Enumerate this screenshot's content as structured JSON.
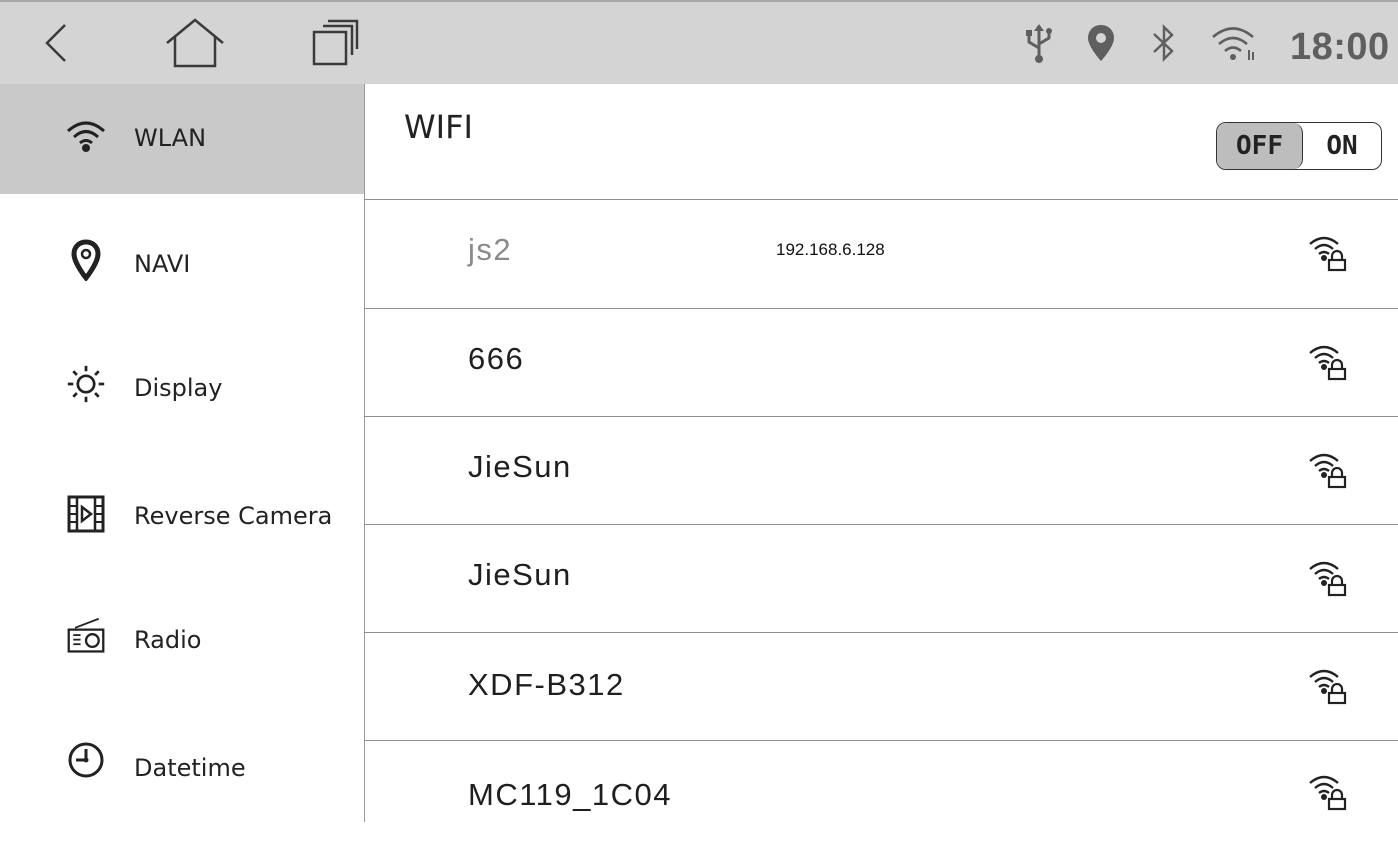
{
  "status_bar": {
    "clock": "18:00",
    "icons": [
      "back-icon",
      "home-icon",
      "recent-apps-icon",
      "usb-icon",
      "location-icon",
      "bluetooth-icon",
      "wifi-icon"
    ]
  },
  "sidebar": {
    "items": [
      {
        "label": "WLAN",
        "icon": "wifi-icon",
        "active": true
      },
      {
        "label": "NAVI",
        "icon": "location-pin-icon"
      },
      {
        "label": "Display",
        "icon": "brightness-icon"
      },
      {
        "label": "Reverse Camera",
        "icon": "film-play-icon"
      },
      {
        "label": "Radio",
        "icon": "radio-icon"
      },
      {
        "label": "Datetime",
        "icon": "clock-icon"
      }
    ]
  },
  "main": {
    "title": "WIFI",
    "toggle": {
      "off_label": "OFF",
      "on_label": "ON",
      "state": "OFF"
    },
    "networks": [
      {
        "ssid": "js2",
        "ip": "192.168.6.128",
        "connected": true,
        "icon": "wifi-lock-icon"
      },
      {
        "ssid": "666",
        "icon": "wifi-lock-icon"
      },
      {
        "ssid": "JieSun",
        "icon": "wifi-lock-icon"
      },
      {
        "ssid": "JieSun",
        "icon": "wifi-lock-icon"
      },
      {
        "ssid": "XDF-B312",
        "icon": "wifi-lock-icon"
      },
      {
        "ssid": "MC119_1C04",
        "icon": "wifi-lock-icon"
      }
    ]
  },
  "colors": {
    "topbar_bg": "#d4d4d4",
    "active_item_bg": "#c9c9c9",
    "status_icon": "#5f5f5f",
    "divider": "#8f8f8f"
  }
}
